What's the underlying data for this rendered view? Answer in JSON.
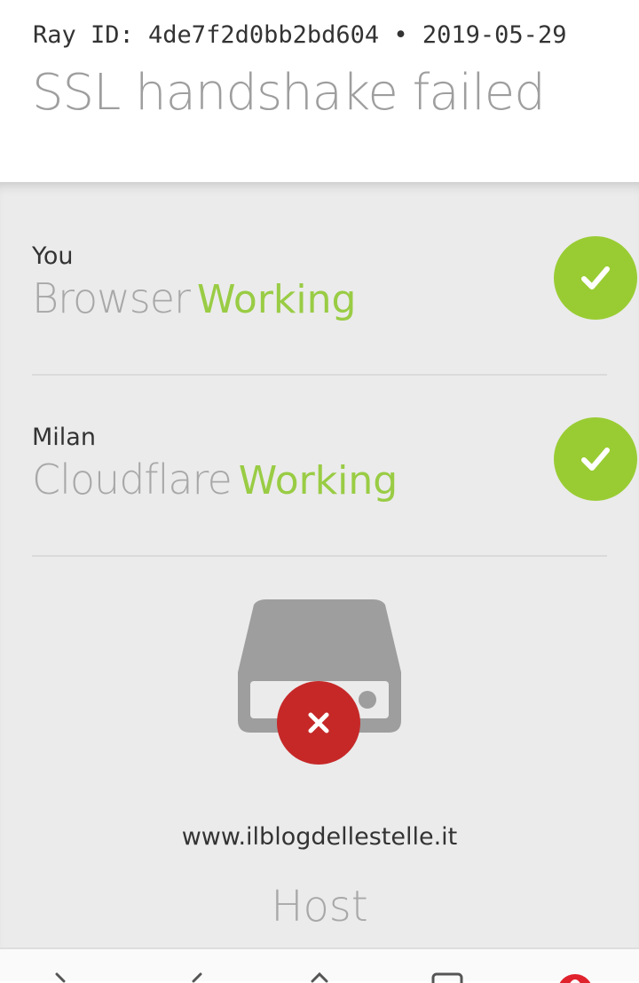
{
  "header": {
    "ray_line": "Ray ID: 4de7f2d0bb2bd604 • 2019-05-29",
    "title": "SSL handshake failed"
  },
  "nodes": [
    {
      "location": "You",
      "name": "Browser",
      "status": "Working",
      "status_icon": "check-icon"
    },
    {
      "location": "Milan",
      "name": "Cloudflare",
      "status": "Working",
      "status_icon": "check-icon"
    }
  ],
  "host": {
    "url": "www.ilblogdellestelle.it",
    "label": "Host",
    "status_icon": "error-x-icon"
  },
  "colors": {
    "ok_green": "#99cc33",
    "error_red": "#c62828",
    "server_gray": "#9e9e9e"
  },
  "navbar": {
    "icons": [
      "back-icon",
      "forward-icon",
      "home-icon",
      "tabs-icon",
      "opera-menu-icon"
    ]
  }
}
